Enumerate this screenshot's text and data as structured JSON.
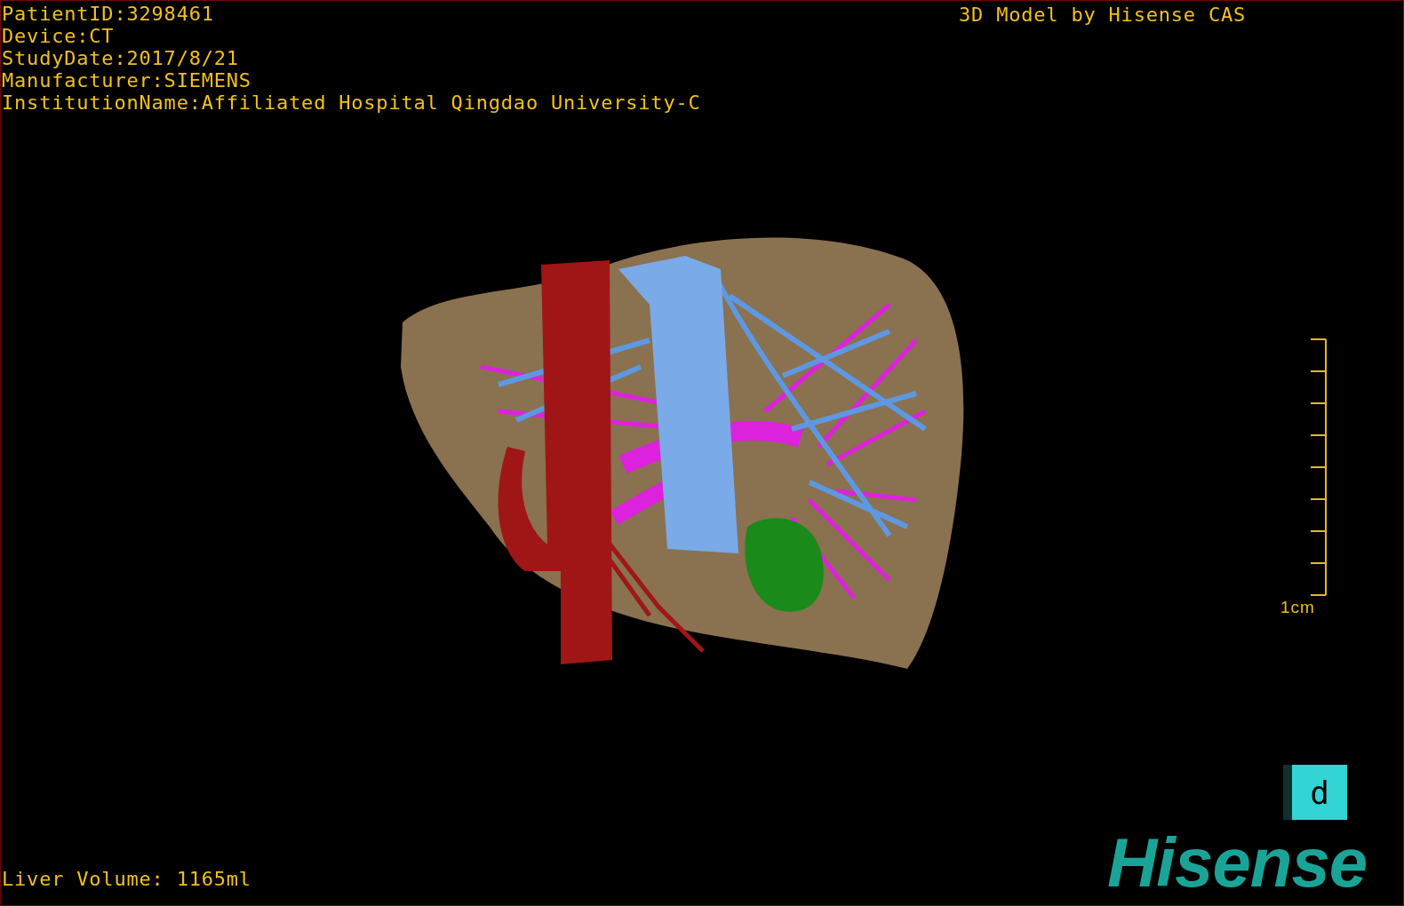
{
  "patient_info": [
    "PatientID:3298461",
    "Device:CT",
    "StudyDate:2017/8/21",
    "Manufacturer:SIEMENS",
    "InstitutionName:Affiliated Hospital Qingdao University-C"
  ],
  "model_credit": "3D Model by Hisense CAS",
  "scale": {
    "label": "1cm"
  },
  "orientation_cube": {
    "label": "d"
  },
  "liver_volume": "Liver Volume: 1165ml",
  "logo": "Hisense"
}
